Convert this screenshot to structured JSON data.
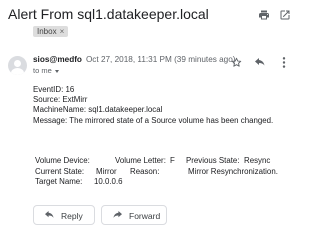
{
  "email": {
    "subject": "Alert From sql1.datakeeper.local",
    "label": "Inbox",
    "label_close": "×",
    "sender": "sios@medfo",
    "date": "Oct 27, 2018, 11:31 PM (39 minutes ago)",
    "to": "to me",
    "body_lines": [
      "EventID: 16",
      "Source: ExtMirr",
      "MachineName: sql1.datakeeper.local",
      "Message: The mirrored state of a Source volume has been changed."
    ],
    "details": {
      "volume_device_label": "Volume Device:",
      "volume_letter_label": "Volume Letter:",
      "volume_letter": "F",
      "previous_state_label": "Previous State:",
      "previous_state": "Resync",
      "current_state_label": "Current State:",
      "current_state": "Mirror",
      "reason_label": "Reason:",
      "reason": "Mirror Resynchronization.",
      "target_name_label": "Target Name:",
      "target_name": "10.0.0.6"
    }
  },
  "actions": {
    "reply": "Reply",
    "forward": "Forward"
  },
  "icons": [
    "print-icon",
    "open-in-new-icon",
    "avatar",
    "star-icon",
    "reply-icon",
    "more-vert-icon",
    "forward-icon"
  ],
  "colors": {
    "text": "#202124",
    "muted": "#5f6368",
    "chip": "#dddddd",
    "border": "#dadce0"
  }
}
